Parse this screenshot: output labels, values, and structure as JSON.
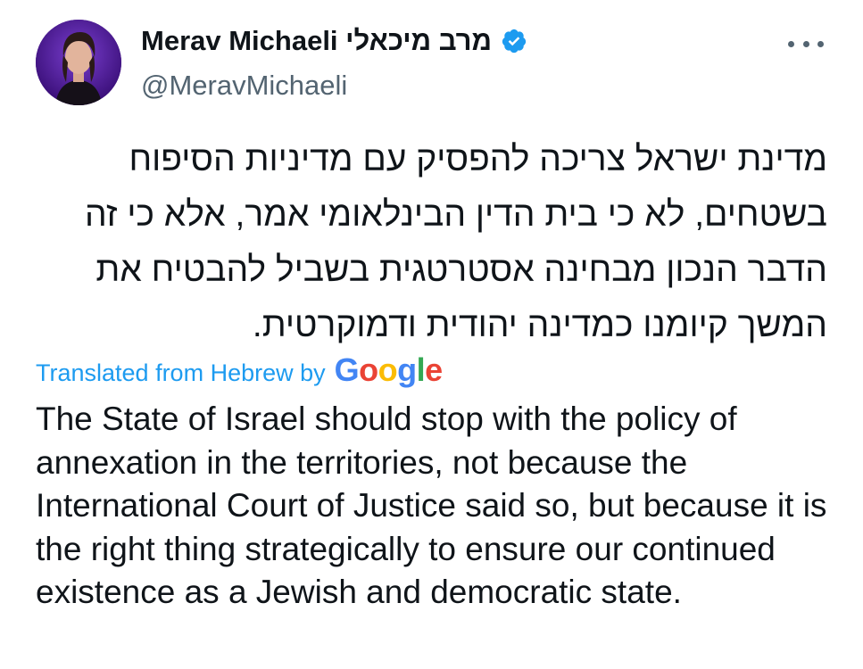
{
  "author": {
    "display_name": "Merav Michaeli מרב מיכאלי",
    "handle": "@MeravMichaeli",
    "verified": true
  },
  "tweet": {
    "hebrew_text": "מדינת ישראל צריכה להפסיק עם מדיניות הסיפוח בשטחים, לא כי בית הדין הבינלאומי אמר, אלא כי זה הדבר הנכון מבחינה אסטרטגית בשביל להבטיח את המשך קיומנו כמדינה יהודית ודמוקרטית.",
    "translated_label": "Translated from Hebrew by",
    "translation_provider": {
      "letters": [
        "G",
        "o",
        "o",
        "g",
        "l",
        "e"
      ]
    },
    "english_text": "The State of Israel should stop with the policy of annexation in the territories, not because the International Court of Justice said so, but because it is the right thing strategically to ensure our continued existence as a Jewish and democratic state."
  },
  "colors": {
    "link": "#1d9bf0",
    "verified": "#1d9bf0",
    "secondary_text": "#536471",
    "avatar_background": "#4b1a8c",
    "google": [
      "#4285F4",
      "#EA4335",
      "#FBBC05",
      "#4285F4",
      "#34A853",
      "#EA4335"
    ]
  },
  "icons": {
    "verified": "verified-badge-icon",
    "more": "more-options-icon"
  }
}
